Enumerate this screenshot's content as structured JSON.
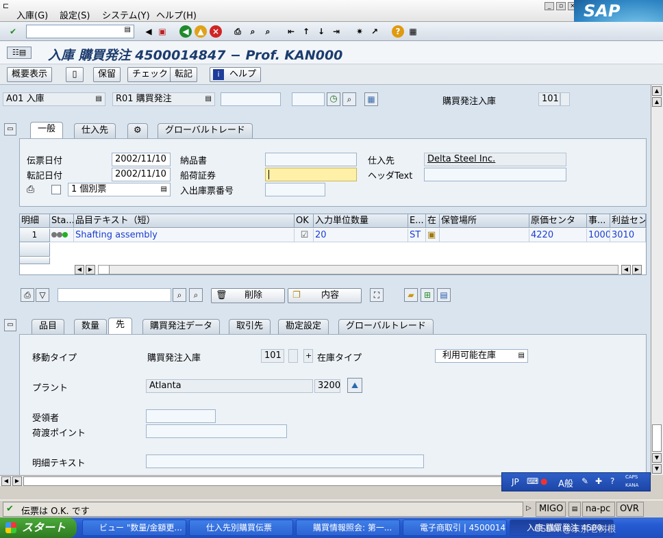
{
  "menu": [
    "入庫(G)",
    "設定(S)",
    "システム(Y)",
    "ヘルプ(H)"
  ],
  "brand": "SAP",
  "title": "入庫 購買発注 4500014847 − Prof. KAN000",
  "app_toolbar": {
    "summary": "概要表示",
    "save": "保留",
    "check": "チェック",
    "post": "転記",
    "help": "ヘルプ"
  },
  "header": {
    "action": "A01 入庫",
    "ref_doc": "R01 購買発注",
    "movement_label": "購買発注入庫",
    "movement_type": "101"
  },
  "header_tabs": [
    "一般",
    "仕入先",
    "グローバルトレード"
  ],
  "general": {
    "doc_date_label": "伝票日付",
    "doc_date": "2002/11/10",
    "post_date_label": "転記日付",
    "post_date": "2002/11/10",
    "delivery_note_label": "納品書",
    "bill_of_lading_label": "船荷証券",
    "vendor_label": "仕入先",
    "vendor": "Delta Steel Inc.",
    "header_text_label": "ヘッダText",
    "slip_option": "1 個別票",
    "gr_slip_no_label": "入出庫票番号"
  },
  "grid": {
    "columns": [
      "明細",
      "Sta...",
      "品目テキスト（短）",
      "OK",
      "入力単位数量",
      "E...",
      "在",
      "保管場所",
      "原価センタ",
      "事...",
      "利益セン"
    ],
    "rows": [
      {
        "line": "1",
        "text": "Shafting assembly",
        "qty": "20",
        "unit": "ST",
        "cost_center": "4220",
        "business_area": "1000",
        "profit_center": "3010"
      }
    ]
  },
  "grid_toolbar": {
    "delete": "削除",
    "content": "内容"
  },
  "item_tabs": [
    "品目",
    "数量",
    "先",
    "購買発注データ",
    "取引先",
    "勘定設定",
    "グローバルトレード"
  ],
  "item": {
    "movement_type_label": "移動タイプ",
    "movement_type_text": "購買発注入庫",
    "movement_type": "101",
    "plus": "+",
    "stock_type_label": "在庫タイプ",
    "stock_type": "利用可能在庫",
    "plant_label": "プラント",
    "plant_name": "Atlanta",
    "plant": "3200",
    "recipient_label": "受領者",
    "unloading_point_label": "荷渡ポイント",
    "item_text_label": "明細テキスト"
  },
  "ime": {
    "lang": "JP",
    "mode": "A般",
    "caps": "CAPS",
    "kana": "KANA"
  },
  "status": {
    "message": "伝票は O.K. です",
    "system": "MIGO",
    "host": "na-pc",
    "mode": "OVR"
  },
  "taskbar": {
    "start": "スタート",
    "items": [
      "ビュー \"数量/金額更...",
      "仕入先別購買伝票",
      "購買情報照会: 第一...",
      "電子商取引 | 4500014...",
      "入庫 購買発注 4500..."
    ]
  },
  "watermark": "CSDN @东京老树根"
}
